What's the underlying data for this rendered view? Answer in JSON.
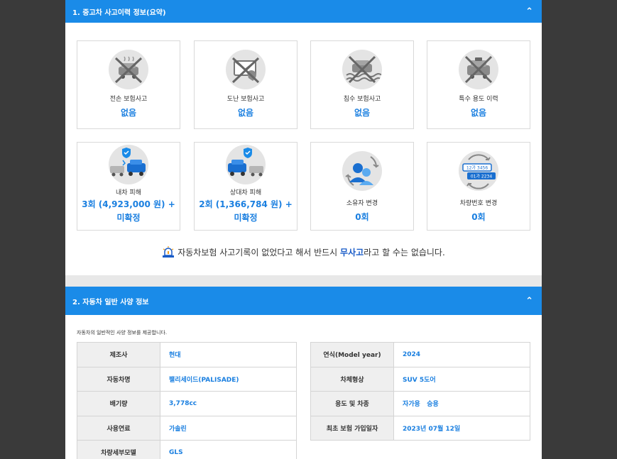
{
  "section1": {
    "title": "1. 중고차 사고이력 정보(요약)",
    "cards": [
      {
        "label": "전손 보험사고",
        "value": "없음",
        "icon": "total-loss-icon"
      },
      {
        "label": "도난 보험사고",
        "value": "없음",
        "icon": "theft-icon"
      },
      {
        "label": "침수 보험사고",
        "value": "없음",
        "icon": "flood-icon"
      },
      {
        "label": "특수 용도 이력",
        "value": "없음",
        "icon": "special-use-icon"
      },
      {
        "label": "내차 피해",
        "value": "3회 (4,923,000 원) +",
        "value2": "미확정",
        "icon": "own-damage-icon"
      },
      {
        "label": "상대차 피해",
        "value": "2회 (1,366,784 원) +",
        "value2": "미확정",
        "icon": "other-damage-icon"
      },
      {
        "label": "소유자 변경",
        "value": "0회",
        "icon": "owner-change-icon"
      },
      {
        "label": "차량번호 변경",
        "value": "0회",
        "icon": "plate-change-icon",
        "plate_old": "12가 3456",
        "plate_new": "01가 2234"
      }
    ],
    "notice_pre": "자동차보험 사고기록이 없었다고 해서 반드시 ",
    "notice_bold": "무사고",
    "notice_post": "라고 할 수는 없습니다."
  },
  "section2": {
    "title": "2. 자동차 일반 사양 정보",
    "description": "자동차의 일반적인 사양 정보를 제공합니다.",
    "left_rows": [
      {
        "key": "제조사",
        "value": "현대"
      },
      {
        "key": "자동차명",
        "value": "팰리세이드(PALISADE)"
      },
      {
        "key": "배기량",
        "value": "3,778cc"
      },
      {
        "key": "사용연료",
        "value": "가솔린"
      },
      {
        "key": "차량세부모델",
        "value": "GLS"
      }
    ],
    "right_rows": [
      {
        "key": "연식(Model year)",
        "value": "2024"
      },
      {
        "key": "차체형상",
        "value": "SUV 5도어"
      },
      {
        "key": "용도 및 차종",
        "value": "자가용   승용"
      },
      {
        "key": "최초 보험 가입일자",
        "value": "2023년 07월 12일"
      }
    ]
  },
  "colors": {
    "accent": "#1a8be8",
    "value_blue": "#1a7fe0",
    "bold_blue": "#1a5cc8"
  }
}
